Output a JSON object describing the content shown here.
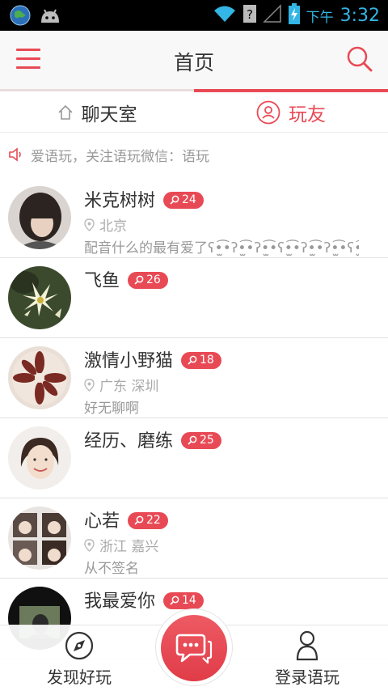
{
  "status_bar": {
    "period": "下午",
    "time": "3:32",
    "icons": [
      "globe-icon",
      "android-icon",
      "wifi-icon",
      "question-signal-icon",
      "cell-signal-icon",
      "battery-charging-icon"
    ]
  },
  "header": {
    "title": "首页",
    "icons": [
      "menu-icon",
      "search-icon"
    ]
  },
  "tabs": [
    {
      "label": "聊天室",
      "icon": "home-icon",
      "active": false
    },
    {
      "label": "玩友",
      "icon": "user-circle-icon",
      "active": true
    }
  ],
  "notice": {
    "icon": "speaker-icon",
    "text": "爱语玩，关注语玩微信：语玩"
  },
  "users": [
    {
      "name": "米克树树",
      "count": "24",
      "location": "北京",
      "signature": "配音什么的最有爱了ʕ•̫͡•ʔ•̫͡•ʔ•̫͡•ʕ•̫͡•ʔ•̫͡•ʔ•̫͡•ʕ•̫͡•ʔ"
    },
    {
      "name": "飞鱼",
      "count": "26",
      "location": "",
      "signature": ""
    },
    {
      "name": "激情小野猫",
      "count": "18",
      "location": "广东 深圳",
      "signature": "好无聊啊"
    },
    {
      "name": "经历、磨练",
      "count": "25",
      "location": "",
      "signature": ""
    },
    {
      "name": "心若",
      "count": "22",
      "location": "浙江 嘉兴",
      "signature": "从不签名"
    },
    {
      "name": "我最爱你",
      "count": "14",
      "location": "",
      "signature": ""
    }
  ],
  "bottom_nav": {
    "discover_label": "发现好玩",
    "login_label": "登录语玩",
    "icons": [
      "globe-compass-icon",
      "chat-bubbles-icon",
      "user-outline-icon"
    ]
  },
  "colors": {
    "accent": "#e84a55",
    "status_blue": "#33b5e5"
  }
}
